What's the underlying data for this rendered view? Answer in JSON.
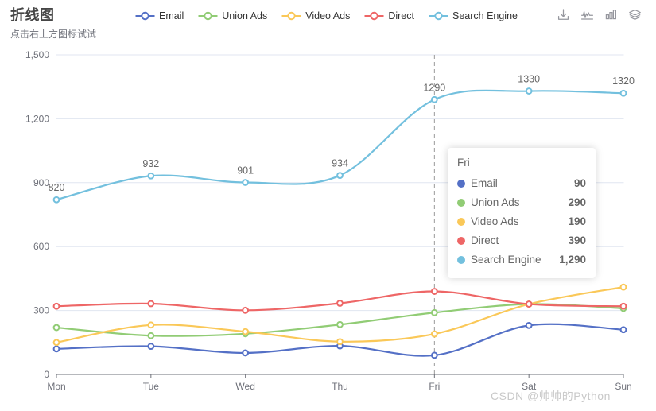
{
  "title": {
    "text": "折线图",
    "subtext": "点击右上方图标试试"
  },
  "legend": {
    "items": [
      {
        "label": "Email",
        "color": "#5470c6",
        "icon": "line-circle-marker"
      },
      {
        "label": "Union Ads",
        "color": "#91cc75",
        "icon": "line-circle-marker"
      },
      {
        "label": "Video Ads",
        "color": "#fac858",
        "icon": "line-circle-marker"
      },
      {
        "label": "Direct",
        "color": "#ee6666",
        "icon": "line-circle-marker"
      },
      {
        "label": "Search Engine",
        "color": "#73c0de",
        "icon": "line-circle-marker"
      }
    ]
  },
  "toolbox": {
    "items": [
      {
        "name": "save-as-image-icon",
        "title": "保存为图片"
      },
      {
        "name": "line-chart-icon",
        "title": "切换为折线图"
      },
      {
        "name": "bar-chart-icon",
        "title": "切换为柱状图"
      },
      {
        "name": "stack-icon",
        "title": "切换为堆叠"
      }
    ]
  },
  "tooltip": {
    "title": "Fri",
    "rows": [
      {
        "name": "Email",
        "value": "90",
        "color": "#5470c6"
      },
      {
        "name": "Union Ads",
        "value": "290",
        "color": "#91cc75"
      },
      {
        "name": "Video Ads",
        "value": "190",
        "color": "#fac858"
      },
      {
        "name": "Direct",
        "value": "390",
        "color": "#ee6666"
      },
      {
        "name": "Search Engine",
        "value": "1,290",
        "color": "#73c0de"
      }
    ]
  },
  "watermark": {
    "text": "CSDN @帅帅的Python"
  },
  "chart_data": {
    "type": "line",
    "title": "折线图",
    "subtitle": "点击右上方图标试试",
    "xlabel": "",
    "ylabel": "",
    "categories": [
      "Mon",
      "Tue",
      "Wed",
      "Thu",
      "Fri",
      "Sat",
      "Sun"
    ],
    "ylim": [
      0,
      1500
    ],
    "yticks": [
      "0",
      "300",
      "600",
      "900",
      "1,200",
      "1,500"
    ],
    "ytick_values": [
      0,
      300,
      600,
      900,
      1200,
      1500
    ],
    "grid": true,
    "legend_position": "top-center",
    "axis_pointer": {
      "type": "line-dashed",
      "category": "Fri"
    },
    "series": [
      {
        "name": "Email",
        "color": "#5470c6",
        "values": [
          120,
          132,
          101,
          134,
          90,
          230,
          210
        ],
        "labels_shown": false
      },
      {
        "name": "Union Ads",
        "color": "#91cc75",
        "values": [
          220,
          182,
          191,
          234,
          290,
          330,
          310
        ],
        "labels_shown": false
      },
      {
        "name": "Video Ads",
        "color": "#fac858",
        "values": [
          150,
          232,
          201,
          154,
          190,
          330,
          410
        ],
        "labels_shown": false
      },
      {
        "name": "Direct",
        "color": "#ee6666",
        "values": [
          320,
          332,
          301,
          334,
          390,
          330,
          320
        ],
        "labels_shown": false
      },
      {
        "name": "Search Engine",
        "color": "#73c0de",
        "values": [
          820,
          932,
          901,
          934,
          1290,
          1330,
          1320
        ],
        "labels_shown": true,
        "labels": [
          "820",
          "932",
          "901",
          "934",
          "1290",
          "1330",
          "1320"
        ]
      }
    ]
  }
}
